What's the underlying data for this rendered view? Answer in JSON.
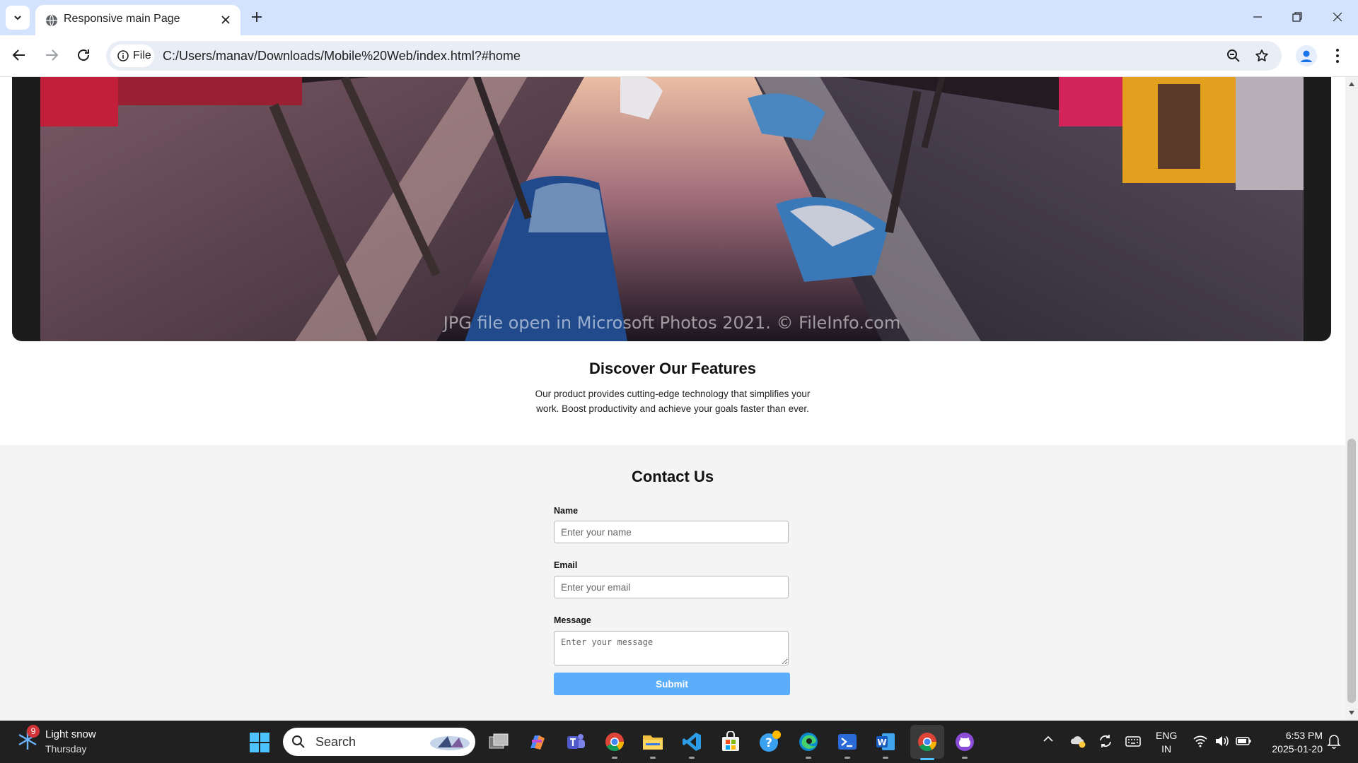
{
  "browser": {
    "tab_title": "Responsive main Page",
    "site_chip_label": "File",
    "url": "C:/Users/manav/Downloads/Mobile%20Web/index.html?#home"
  },
  "hero": {
    "watermark": "JPG file open in Microsoft Photos 2021. © FileInfo.com"
  },
  "features": {
    "title": "Discover Our Features",
    "description": "Our product provides cutting-edge technology that simplifies your work. Boost productivity and achieve your goals faster than ever."
  },
  "contact": {
    "title": "Contact Us",
    "name_label": "Name",
    "name_placeholder": "Enter your name",
    "email_label": "Email",
    "email_placeholder": "Enter your email",
    "message_label": "Message",
    "message_placeholder": "Enter your message",
    "submit_label": "Submit",
    "submit_color": "#5aaefb"
  },
  "taskbar": {
    "weather_badge": "9",
    "weather_condition": "Light snow",
    "weather_day": "Thursday",
    "search_label": "Search",
    "lang_line1": "ENG",
    "lang_line2": "IN",
    "time": "6:53 PM",
    "date": "2025-01-20",
    "apps": [
      "copilot-icon",
      "teams-icon",
      "chrome-icon",
      "file-explorer-icon",
      "vscode-icon",
      "store-icon",
      "help-icon",
      "edge-icon",
      "terminal-icon",
      "word-icon",
      "chrome-active-icon",
      "github-desktop-icon"
    ]
  }
}
